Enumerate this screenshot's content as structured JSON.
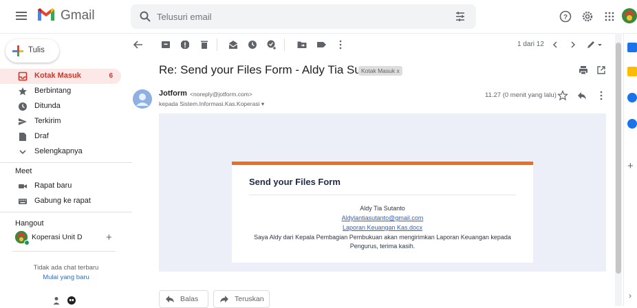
{
  "app": {
    "name": "Gmail"
  },
  "search": {
    "placeholder": "Telusuri email"
  },
  "compose": {
    "label": "Tulis"
  },
  "nav": [
    {
      "label": "Kotak Masuk",
      "count": "6",
      "icon": "inbox-icon",
      "active": true
    },
    {
      "label": "Berbintang",
      "icon": "star-icon"
    },
    {
      "label": "Ditunda",
      "icon": "clock-icon"
    },
    {
      "label": "Terkirim",
      "icon": "send-icon"
    },
    {
      "label": "Draf",
      "icon": "draft-icon"
    },
    {
      "label": "Selengkapnya",
      "icon": "chevron-down-icon"
    }
  ],
  "meet": {
    "title": "Meet",
    "items": [
      {
        "label": "Rapat baru",
        "icon": "video-icon"
      },
      {
        "label": "Gabung ke rapat",
        "icon": "keyboard-icon"
      }
    ]
  },
  "hangout": {
    "title": "Hangout",
    "user": "Koperasi Unit D",
    "no_chat": "Tidak ada chat terbaru",
    "start_new": "Mulai yang baru"
  },
  "pagination": {
    "text": "1 dari 12"
  },
  "email": {
    "subject": "Re: Send your Files Form - Aldy Tia Sutanto",
    "label": "Kotak Masuk x",
    "sender_name": "Jotform",
    "sender_email": "<noreply@jotform.com>",
    "recipient": "kepada Sistem.Informasi.Kas.Koperasi ▾",
    "time": "11.27 (0 menit yang lalu)"
  },
  "form_card": {
    "title": "Send your Files Form",
    "name": "Aldy Tia Sutanto",
    "email_link": "Aldylantiasutanto@gmail.com",
    "file_link": "Laporan Keuangan Kas.docx",
    "message_1": "Saya Aldy dari Kepala Pembagian Pembukuan akan mengirimkan Laporan Keuangan kepada",
    "message_2": "Pengurus, terima kasih.",
    "accent_color": "#f26c1d"
  },
  "actions": {
    "reply": "Balas",
    "forward": "Teruskan"
  },
  "colors": {
    "accent_red": "#d93025",
    "active_bg": "#fce8e6",
    "link_blue": "#1a73e8"
  }
}
